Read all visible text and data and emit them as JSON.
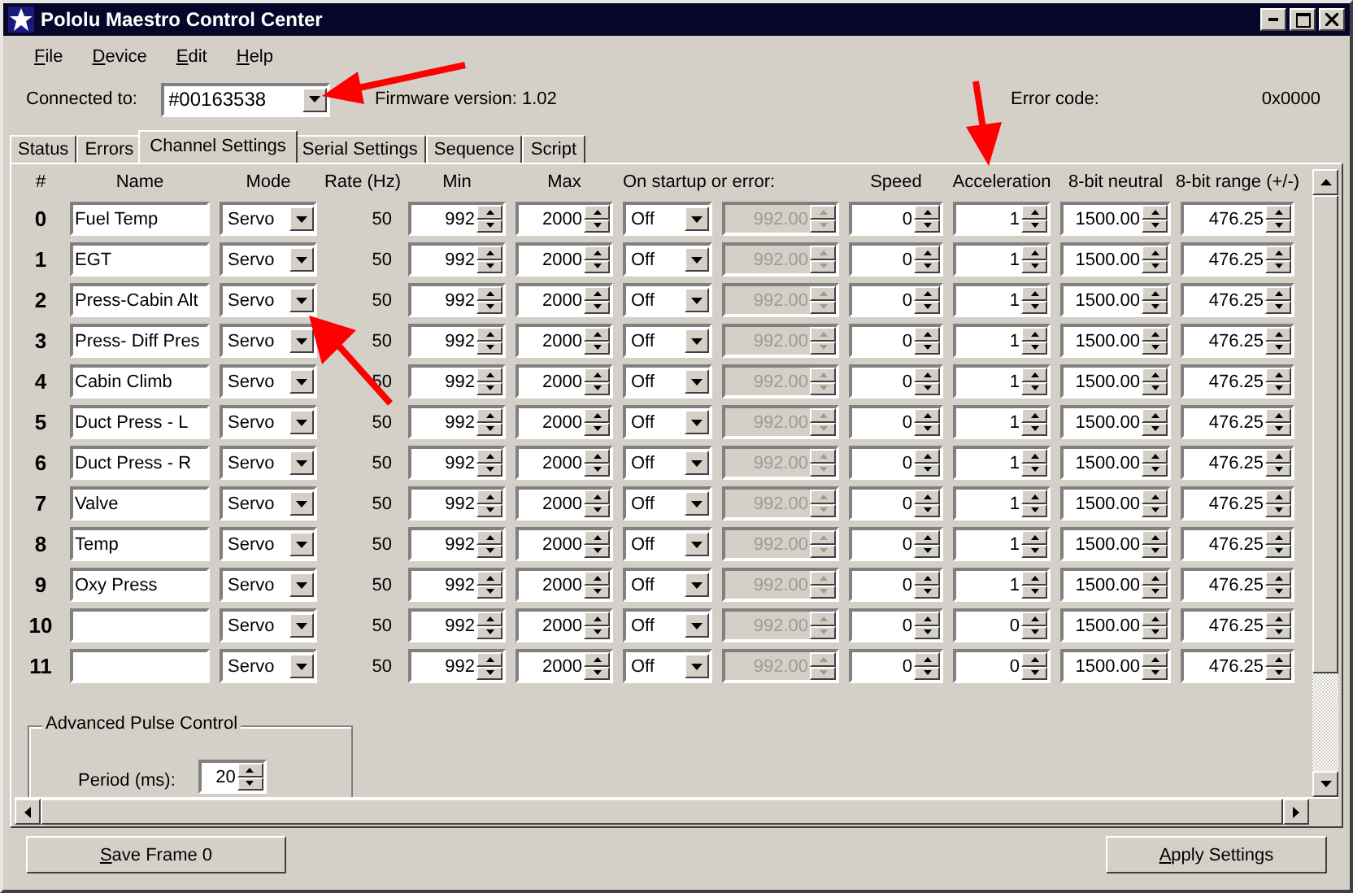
{
  "window": {
    "title": "Pololu Maestro Control Center"
  },
  "menu": [
    {
      "label": "File"
    },
    {
      "label": "Device"
    },
    {
      "label": "Edit"
    },
    {
      "label": "Help"
    }
  ],
  "connection": {
    "label": "Connected to:",
    "device": "#00163538",
    "firmware": "Firmware version: 1.02",
    "error_label": "Error code:",
    "error_code": "0x0000"
  },
  "tabs": [
    {
      "label": "Status",
      "selected": false
    },
    {
      "label": "Errors",
      "selected": false
    },
    {
      "label": "Channel Settings",
      "selected": true
    },
    {
      "label": "Serial Settings",
      "selected": false
    },
    {
      "label": "Sequence",
      "selected": false
    },
    {
      "label": "Script",
      "selected": false
    }
  ],
  "table": {
    "columns": [
      {
        "label": "#"
      },
      {
        "label": "Name"
      },
      {
        "label": "Mode"
      },
      {
        "label": "Rate (Hz)"
      },
      {
        "label": "Min"
      },
      {
        "label": "Max"
      },
      {
        "label": "On startup or error:"
      },
      {
        "label": "Speed"
      },
      {
        "label": "Acceleration"
      },
      {
        "label": "8-bit neutral"
      },
      {
        "label": "8-bit range (+/-)"
      }
    ],
    "rows": [
      {
        "number": "0",
        "name": "Fuel Temp",
        "mode": "Servo",
        "rate": "50",
        "min": "992",
        "max": "2000",
        "startup": "Off",
        "startup_value": "992.00",
        "startup_value_disabled": true,
        "speed": "0",
        "acceleration": "1",
        "neutral": "1500.00",
        "range": "476.25"
      },
      {
        "number": "1",
        "name": "EGT",
        "mode": "Servo",
        "rate": "50",
        "min": "992",
        "max": "2000",
        "startup": "Off",
        "startup_value": "992.00",
        "startup_value_disabled": true,
        "speed": "0",
        "acceleration": "1",
        "neutral": "1500.00",
        "range": "476.25"
      },
      {
        "number": "2",
        "name": "Press-Cabin Alt",
        "mode": "Servo",
        "rate": "50",
        "min": "992",
        "max": "2000",
        "startup": "Off",
        "startup_value": "992.00",
        "startup_value_disabled": true,
        "speed": "0",
        "acceleration": "1",
        "neutral": "1500.00",
        "range": "476.25"
      },
      {
        "number": "3",
        "name": "Press- Diff Pres",
        "mode": "Servo",
        "rate": "50",
        "min": "992",
        "max": "2000",
        "startup": "Off",
        "startup_value": "992.00",
        "startup_value_disabled": true,
        "speed": "0",
        "acceleration": "1",
        "neutral": "1500.00",
        "range": "476.25"
      },
      {
        "number": "4",
        "name": "Cabin Climb",
        "mode": "Servo",
        "rate": "50",
        "min": "992",
        "max": "2000",
        "startup": "Off",
        "startup_value": "992.00",
        "startup_value_disabled": true,
        "speed": "0",
        "acceleration": "1",
        "neutral": "1500.00",
        "range": "476.25"
      },
      {
        "number": "5",
        "name": "Duct Press - L",
        "mode": "Servo",
        "rate": "50",
        "min": "992",
        "max": "2000",
        "startup": "Off",
        "startup_value": "992.00",
        "startup_value_disabled": true,
        "speed": "0",
        "acceleration": "1",
        "neutral": "1500.00",
        "range": "476.25"
      },
      {
        "number": "6",
        "name": "Duct Press - R",
        "mode": "Servo",
        "rate": "50",
        "min": "992",
        "max": "2000",
        "startup": "Off",
        "startup_value": "992.00",
        "startup_value_disabled": true,
        "speed": "0",
        "acceleration": "1",
        "neutral": "1500.00",
        "range": "476.25"
      },
      {
        "number": "7",
        "name": "Valve",
        "mode": "Servo",
        "rate": "50",
        "min": "992",
        "max": "2000",
        "startup": "Off",
        "startup_value": "992.00",
        "startup_value_disabled": true,
        "speed": "0",
        "acceleration": "1",
        "neutral": "1500.00",
        "range": "476.25"
      },
      {
        "number": "8",
        "name": "Temp",
        "mode": "Servo",
        "rate": "50",
        "min": "992",
        "max": "2000",
        "startup": "Off",
        "startup_value": "992.00",
        "startup_value_disabled": true,
        "speed": "0",
        "acceleration": "1",
        "neutral": "1500.00",
        "range": "476.25"
      },
      {
        "number": "9",
        "name": "Oxy Press",
        "mode": "Servo",
        "rate": "50",
        "min": "992",
        "max": "2000",
        "startup": "Off",
        "startup_value": "992.00",
        "startup_value_disabled": true,
        "speed": "0",
        "acceleration": "1",
        "neutral": "1500.00",
        "range": "476.25"
      },
      {
        "number": "10",
        "mode": "Servo",
        "rate": "50",
        "min": "992",
        "max": "2000",
        "startup": "Off",
        "startup_value": "992.00",
        "startup_value_disabled": true,
        "speed": "0",
        "acceleration": "0",
        "neutral": "1500.00",
        "range": "476.25"
      },
      {
        "number": "11",
        "mode": "Servo",
        "rate": "50",
        "min": "992",
        "max": "2000",
        "startup": "Off",
        "startup_value": "992.00",
        "startup_value_disabled": true,
        "speed": "0",
        "acceleration": "0",
        "neutral": "1500.00",
        "range": "476.25"
      }
    ]
  },
  "advanced": {
    "title": "Advanced Pulse Control",
    "period_label": "Period (ms):",
    "period": "20"
  },
  "buttons": [
    {
      "label": "Save Frame 0"
    },
    {
      "label": "Apply Settings"
    }
  ]
}
